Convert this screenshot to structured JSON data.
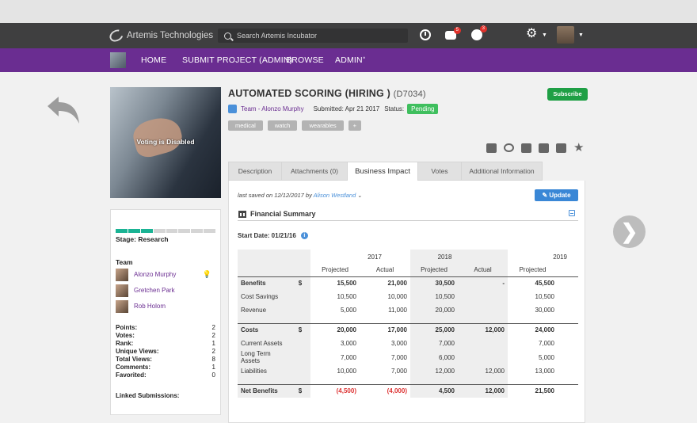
{
  "topbar": {
    "brand": "Artemis Technologies",
    "search_placeholder": "Search Artemis Incubator",
    "chat_badge": "5",
    "alerts_badge": "3"
  },
  "nav": {
    "items": [
      "HOME",
      "SUBMIT PROJECT (ADMIN)",
      "BROWSE",
      "ADMIN"
    ]
  },
  "hero": {
    "overlay": "Voting is Disabled"
  },
  "sidebar": {
    "stage_done": 3,
    "stage_total": 8,
    "stage_label": "Stage: Research",
    "team_title": "Team",
    "members": [
      "Alonzo Murphy",
      "Gretchen Park",
      "Rob Holom"
    ],
    "stats": [
      {
        "label": "Points:",
        "value": "2"
      },
      {
        "label": "Votes:",
        "value": "2"
      },
      {
        "label": "Rank:",
        "value": "1"
      },
      {
        "label": "Unique Views:",
        "value": "2"
      },
      {
        "label": "Total Views:",
        "value": "8"
      },
      {
        "label": "Comments:",
        "value": "1"
      },
      {
        "label": "Favorited:",
        "value": "0"
      }
    ],
    "linked": "Linked Submissions:"
  },
  "project": {
    "title": "AUTOMATED SCORING (HIRING )",
    "code": "(D7034)",
    "subscribe": "Subscribe",
    "team": "Team - Alonzo Murphy",
    "submitted": "Submitted: Apr 21 2017",
    "status_label": "Status:",
    "status": "Pending",
    "tags": [
      "medical",
      "watch",
      "wearables",
      "+"
    ]
  },
  "tabs": [
    "Description",
    "Attachments (0)",
    "Business Impact",
    "Votes",
    "Additional Information"
  ],
  "panel": {
    "saved_prefix": "last saved on 12/12/2017 by",
    "saved_by": "Alison Westland",
    "update": "Update",
    "section_title": "Financial Summary",
    "start_date": "Start Date: 01/21/16"
  },
  "table": {
    "years": [
      "2017",
      "2018",
      "2019"
    ],
    "headers": [
      "Projected",
      "Actual",
      "Projected",
      "Actual",
      "Projected"
    ],
    "rows": [
      {
        "name": "Benefits",
        "dollar": "$",
        "vals": [
          "15,500",
          "21,000",
          "30,500",
          "-",
          "45,500"
        ],
        "bold": true
      },
      {
        "name": "Cost Savings",
        "dollar": "",
        "vals": [
          "10,500",
          "10,000",
          "10,500",
          "",
          "10,500"
        ]
      },
      {
        "name": "Revenue",
        "dollar": "",
        "vals": [
          "5,000",
          "11,000",
          "20,000",
          "",
          "30,000"
        ]
      },
      {
        "name": "Costs",
        "dollar": "$",
        "vals": [
          "20,000",
          "17,000",
          "25,000",
          "12,000",
          "24,000"
        ],
        "bold": true
      },
      {
        "name": "Current Assets",
        "dollar": "",
        "vals": [
          "3,000",
          "3,000",
          "7,000",
          "",
          "7,000"
        ]
      },
      {
        "name": "Long Term Assets",
        "dollar": "",
        "vals": [
          "7,000",
          "7,000",
          "6,000",
          "",
          "5,000"
        ]
      },
      {
        "name": "Liabilities",
        "dollar": "",
        "vals": [
          "10,000",
          "7,000",
          "12,000",
          "12,000",
          "13,000"
        ]
      },
      {
        "name": "Net Benefits",
        "dollar": "$",
        "vals": [
          "(4,500)",
          "(4,000)",
          "4,500",
          "12,000",
          "21,500"
        ],
        "bold": true
      }
    ]
  }
}
